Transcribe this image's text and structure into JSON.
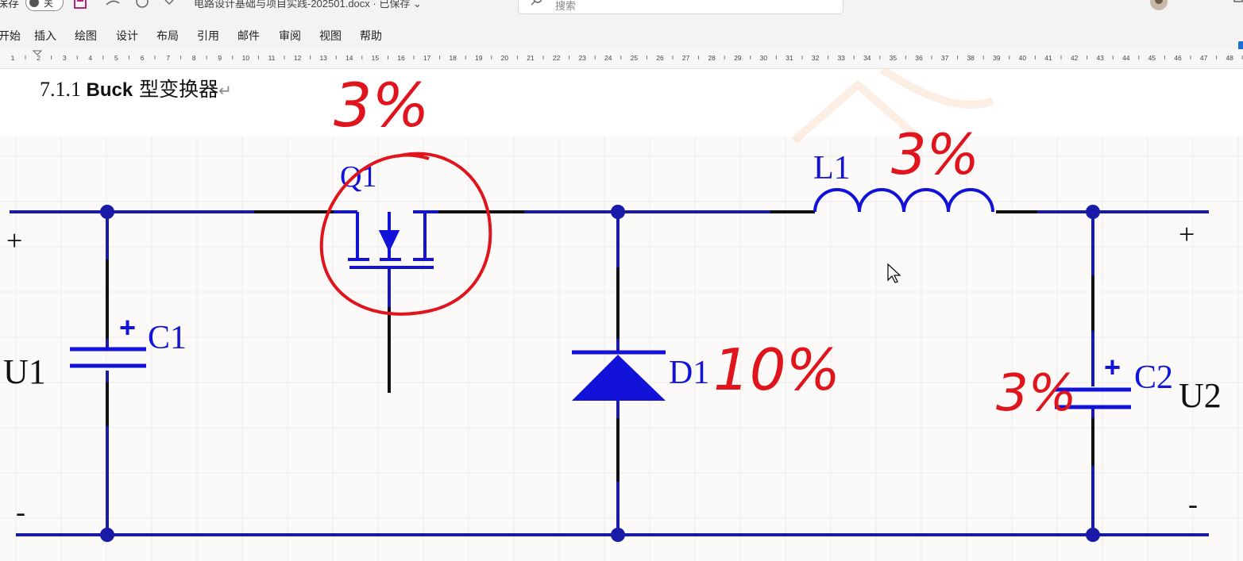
{
  "titlebar": {
    "autosave_label": "保存",
    "autosave_state": "关",
    "doc_title": "电路设计基础与项目实践-202501.docx · 已保存 ⌄",
    "search_placeholder": "搜索"
  },
  "menu": [
    "开始",
    "插入",
    "绘图",
    "设计",
    "布局",
    "引用",
    "邮件",
    "审阅",
    "视图",
    "帮助"
  ],
  "ruler": {
    "ticks": [
      "1",
      "2",
      "3",
      "4",
      "5",
      "6",
      "7",
      "8",
      "9",
      "10",
      "11",
      "12",
      "13",
      "14",
      "15",
      "16",
      "17",
      "18",
      "19",
      "20",
      "21",
      "22",
      "23",
      "24",
      "25",
      "26",
      "27",
      "28",
      "29",
      "30",
      "31",
      "32",
      "33",
      "34",
      "35",
      "36",
      "37",
      "38",
      "39",
      "40",
      "41",
      "42",
      "43",
      "44",
      "45",
      "46",
      "47",
      "48"
    ]
  },
  "document": {
    "heading": {
      "number": "7.1.1 ",
      "bold": "Buck",
      "rest": " 型变换器",
      "mark": "↵"
    },
    "circuit": {
      "labels": {
        "q1": "Q1",
        "l1": "L1",
        "c1": "C1",
        "c2": "C2",
        "d1": "D1",
        "u1": "U1",
        "u2": "U2",
        "plus": "+",
        "minus": "-",
        "c1_plus": "+",
        "c2_plus": "+"
      }
    },
    "annotations": {
      "q1": "3%",
      "l1": "3%",
      "d1": "10%",
      "c2": "3%"
    }
  },
  "colors": {
    "wire": "#1a1aa8",
    "component": "#1212d8",
    "annotation": "#e0141c",
    "grid": "#ececec"
  }
}
